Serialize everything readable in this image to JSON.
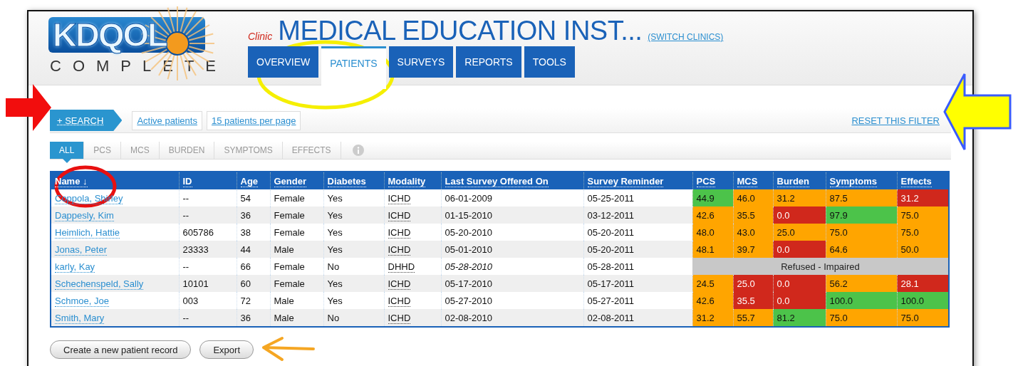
{
  "logo": {
    "name": "KDQOL",
    "tagline": "COMPLETE"
  },
  "header": {
    "clinic_label": "Clinic",
    "clinic_name": "MEDICAL EDUCATION INST...",
    "switch_link": "(SWITCH CLINICS)"
  },
  "nav_tabs": [
    {
      "label": "OVERVIEW",
      "selected": false
    },
    {
      "label": "PATIENTS",
      "selected": true
    },
    {
      "label": "SURVEYS",
      "selected": false
    },
    {
      "label": "REPORTS",
      "selected": false
    },
    {
      "label": "TOOLS",
      "selected": false
    }
  ],
  "filter_bar": {
    "search_button": "+ SEARCH",
    "filters": [
      "Active patients",
      "15 patients per page"
    ],
    "reset_link": "RESET THIS FILTER"
  },
  "score_tabs": [
    {
      "label": "ALL",
      "selected": true
    },
    {
      "label": "PCS",
      "selected": false
    },
    {
      "label": "MCS",
      "selected": false
    },
    {
      "label": "BURDEN",
      "selected": false
    },
    {
      "label": "SYMPTOMS",
      "selected": false
    },
    {
      "label": "EFFECTS",
      "selected": false
    }
  ],
  "table": {
    "columns": [
      "Name ↓",
      "ID",
      "Age",
      "Gender",
      "Diabetes",
      "Modality",
      "Last Survey Offered On",
      "Survey Reminder",
      "PCS",
      "MCS",
      "Burden",
      "Symptoms",
      "Effects"
    ],
    "rows": [
      {
        "name": "Coppola, Shirley",
        "id": "--",
        "age": "54",
        "gender": "Female",
        "diabetes": "Yes",
        "modality": "ICHD",
        "last_survey": "06-01-2009",
        "last_survey_italic": false,
        "reminder": "05-25-2011",
        "scores": [
          {
            "value": "44.9",
            "color": "#4cc34a"
          },
          {
            "value": "46.0",
            "color": "#ffa500"
          },
          {
            "value": "31.2",
            "color": "#ffa500"
          },
          {
            "value": "87.5",
            "color": "#ffa500"
          },
          {
            "value": "31.2",
            "color": "#d0281c"
          }
        ]
      },
      {
        "name": "Dappesly, Kim",
        "id": "--",
        "age": "36",
        "gender": "Female",
        "diabetes": "Yes",
        "modality": "ICHD",
        "last_survey": "01-15-2010",
        "last_survey_italic": false,
        "reminder": "03-12-2011",
        "scores": [
          {
            "value": "42.6",
            "color": "#ffa500"
          },
          {
            "value": "35.5",
            "color": "#ffa500"
          },
          {
            "value": "0.0",
            "color": "#d0281c"
          },
          {
            "value": "97.9",
            "color": "#4cc34a"
          },
          {
            "value": "75.0",
            "color": "#ffa500"
          }
        ]
      },
      {
        "name": "Heimlich, Hattie",
        "id": "605786",
        "age": "38",
        "gender": "Female",
        "diabetes": "Yes",
        "modality": "ICHD",
        "last_survey": "05-20-2010",
        "last_survey_italic": false,
        "reminder": "05-20-2011",
        "scores": [
          {
            "value": "48.0",
            "color": "#ffa500"
          },
          {
            "value": "43.0",
            "color": "#ffa500"
          },
          {
            "value": "25.0",
            "color": "#ffa500"
          },
          {
            "value": "75.0",
            "color": "#ffa500"
          },
          {
            "value": "75.0",
            "color": "#ffa500"
          }
        ]
      },
      {
        "name": "Jonas, Peter",
        "id": "23333",
        "age": "44",
        "gender": "Male",
        "diabetes": "Yes",
        "modality": "ICHD",
        "last_survey": "05-01-2010",
        "last_survey_italic": false,
        "reminder": "05-20-2011",
        "scores": [
          {
            "value": "48.1",
            "color": "#ffa500"
          },
          {
            "value": "39.7",
            "color": "#ffa500"
          },
          {
            "value": "0.0",
            "color": "#d0281c"
          },
          {
            "value": "64.6",
            "color": "#ffa500"
          },
          {
            "value": "50.0",
            "color": "#ffa500"
          }
        ]
      },
      {
        "name": "karly, Kay",
        "id": "--",
        "age": "66",
        "gender": "Female",
        "diabetes": "No",
        "modality": "DHHD",
        "last_survey": "05-28-2010",
        "last_survey_italic": true,
        "reminder": "05-28-2011",
        "scores_note": "Refused - Impaired"
      },
      {
        "name": "Schechenspeld, Sally",
        "id": "10101",
        "age": "60",
        "gender": "Female",
        "diabetes": "Yes",
        "modality": "ICHD",
        "last_survey": "05-17-2010",
        "last_survey_italic": false,
        "reminder": "05-17-2011",
        "scores": [
          {
            "value": "24.5",
            "color": "#ffa500"
          },
          {
            "value": "25.0",
            "color": "#d0281c"
          },
          {
            "value": "0.0",
            "color": "#d0281c"
          },
          {
            "value": "56.2",
            "color": "#ffa500"
          },
          {
            "value": "28.1",
            "color": "#d0281c"
          }
        ]
      },
      {
        "name": "Schmoe, Joe",
        "id": "003",
        "age": "72",
        "gender": "Male",
        "diabetes": "Yes",
        "modality": "ICHD",
        "last_survey": "05-27-2010",
        "last_survey_italic": false,
        "reminder": "05-27-2011",
        "scores": [
          {
            "value": "42.6",
            "color": "#ffa500"
          },
          {
            "value": "35.5",
            "color": "#d0281c"
          },
          {
            "value": "0.0",
            "color": "#d0281c"
          },
          {
            "value": "100.0",
            "color": "#4cc34a"
          },
          {
            "value": "100.0",
            "color": "#4cc34a"
          }
        ]
      },
      {
        "name": "Smith, Mary",
        "id": "--",
        "age": "36",
        "gender": "Male",
        "diabetes": "No",
        "modality": "ICHD",
        "last_survey": "02-08-2010",
        "last_survey_italic": false,
        "reminder": "02-08-2011",
        "scores": [
          {
            "value": "31.2",
            "color": "#ffa500"
          },
          {
            "value": "55.7",
            "color": "#ffa500"
          },
          {
            "value": "81.2",
            "color": "#4cc34a"
          },
          {
            "value": "75.0",
            "color": "#ffa500"
          },
          {
            "value": "75.0",
            "color": "#ffa500"
          }
        ]
      }
    ]
  },
  "actions": [
    "Create a new patient record",
    "Export"
  ]
}
